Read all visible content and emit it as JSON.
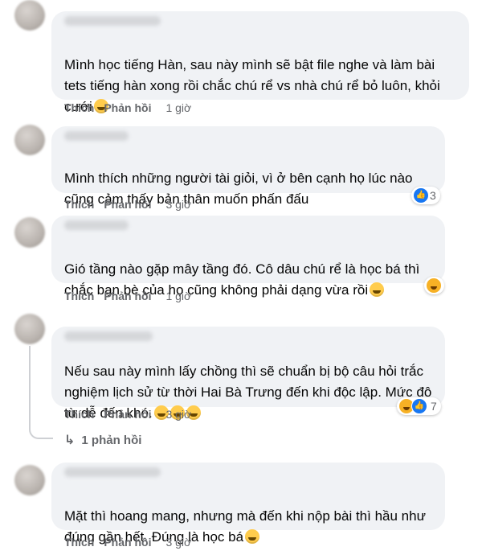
{
  "actions": {
    "like": "Thích",
    "reply": "Phản hồi"
  },
  "comments": [
    {
      "text": "Mình học tiếng Hàn, sau này mình sẽ bật file nghe và làm bài tets tiếng hàn xong rồi chắc chú rể vs nhà chú rể bỏ luôn, khỏi cưới",
      "emoji": "smiley-emoji",
      "time": "1 giờ"
    },
    {
      "text": "Mình thích những người tài giỏi, vì ở bên cạnh họ lúc nào cũng cảm thấy bản thân muốn phấn đấu",
      "time": "3 giờ",
      "reactions": {
        "icons": [
          "like-icon"
        ],
        "count": "3"
      }
    },
    {
      "text": "Gió tầng nào gặp mây tầng đó. Cô dâu chú rể là học bá thì chắc bạn bè của họ cũng không phải dạng vừa rồi",
      "emoji": "grin-emoji",
      "time": "1 giờ",
      "reactions": {
        "icons": [
          "care-icon"
        ],
        "count": ""
      }
    },
    {
      "text": "Nếu sau này mình lấy chồng thì sẽ chuẩn bị bộ câu hỏi trắc nghiệm lịch sử từ thời Hai Bà Trưng đến khi độc lập. Mức độ từ dễ đến khó.",
      "emoji": "rofl-emoji x3",
      "time": "3 giờ",
      "reactions": {
        "icons": [
          "haha-icon",
          "like-icon"
        ],
        "count": "7"
      },
      "replies_label": "1 phản hồi"
    },
    {
      "text": "Mặt thì hoang mang, nhưng mà đến khi nộp bài thì hầu như đúng gần hết. Đúng là học bá",
      "emoji": "astonished-emoji",
      "time": "3 giờ"
    }
  ],
  "colors": {
    "bubble": "#f0f2f5",
    "meta": "#65676b",
    "like": "#1877f2",
    "haha": "#f7b125"
  }
}
